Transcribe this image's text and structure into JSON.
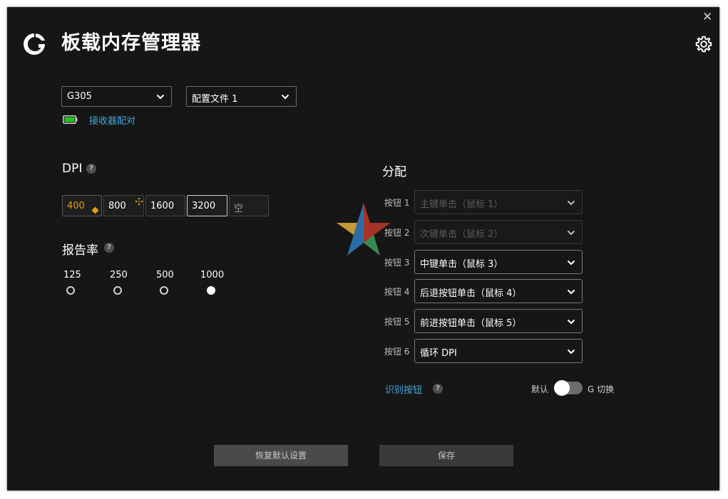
{
  "app": {
    "title": "板载内存管理器"
  },
  "window": {
    "close_glyph": "✕"
  },
  "device_select": {
    "value": "G305"
  },
  "profile_select": {
    "value": "配置文件 1"
  },
  "receiver": {
    "pair_label": "接收器配对",
    "battery_color": "#22c322"
  },
  "dpi": {
    "label": "DPI",
    "help": "?",
    "levels": [
      "400",
      "800",
      "1600",
      "3200",
      "空"
    ],
    "active_color": "#e5a00d"
  },
  "report_rate": {
    "label": "报告率",
    "help": "?",
    "options": [
      "125",
      "250",
      "500",
      "1000"
    ],
    "selected": "1000"
  },
  "assignment": {
    "label": "分配",
    "buttons": [
      {
        "label": "按钮 1",
        "value": "主键单击（鼠标 1）",
        "disabled": true
      },
      {
        "label": "按钮 2",
        "value": "次键单击（鼠标 2）",
        "disabled": true
      },
      {
        "label": "按钮 3",
        "value": "中键单击（鼠标 3）",
        "disabled": false
      },
      {
        "label": "按钮 4",
        "value": "后退按钮单击（鼠标 4）",
        "disabled": false
      },
      {
        "label": "按钮 5",
        "value": "前进按钮单击（鼠标 5）",
        "disabled": false
      },
      {
        "label": "按钮 6",
        "value": "循环 DPI",
        "disabled": false
      }
    ],
    "identify_label": "识别按钮",
    "help": "?",
    "toggle_left": "默认",
    "toggle_right": "G 切换",
    "toggle_on": false
  },
  "footer": {
    "restore_label": "恢复默认设置",
    "save_label": "保存"
  },
  "colors": {
    "background": "#161616",
    "accent_link": "#3fa9e0"
  }
}
